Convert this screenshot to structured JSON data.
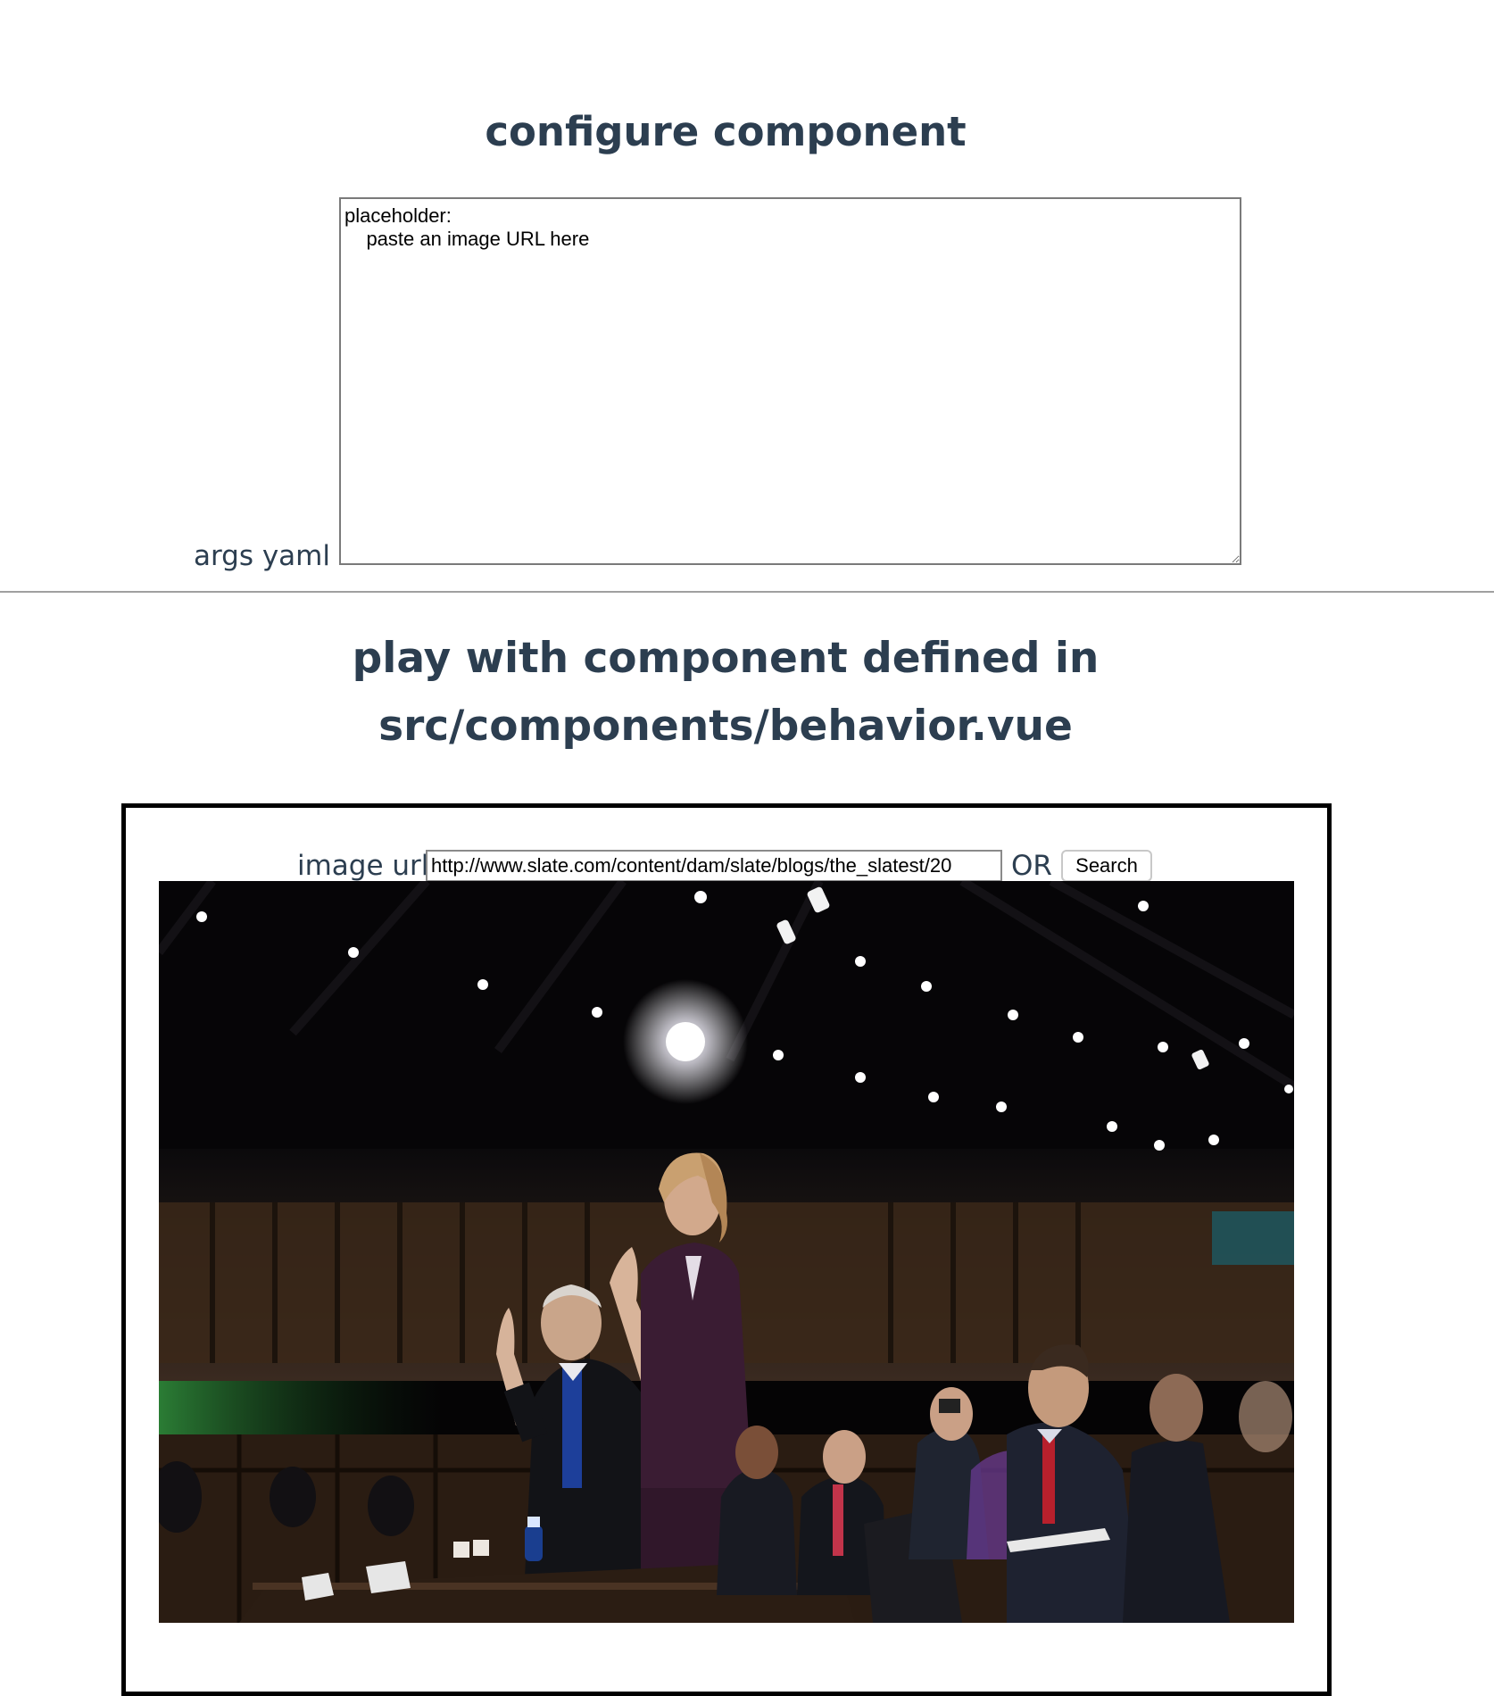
{
  "config": {
    "title": "configure component",
    "args_label": "args yaml",
    "args_yaml": "placeholder:\n    paste an image URL here"
  },
  "playground": {
    "title": "play with component defined in src/components/behavior.vue"
  },
  "component": {
    "image_url_label": "image url",
    "image_url_value": "http://www.slate.com/content/dam/slate/blogs/the_slatest/20",
    "or_label": "OR",
    "search_label": "Search",
    "photo_name": "hearing-room-photo"
  },
  "colors": {
    "heading": "#2c3e50",
    "border": "#000000",
    "divider": "#a0a0a0"
  }
}
